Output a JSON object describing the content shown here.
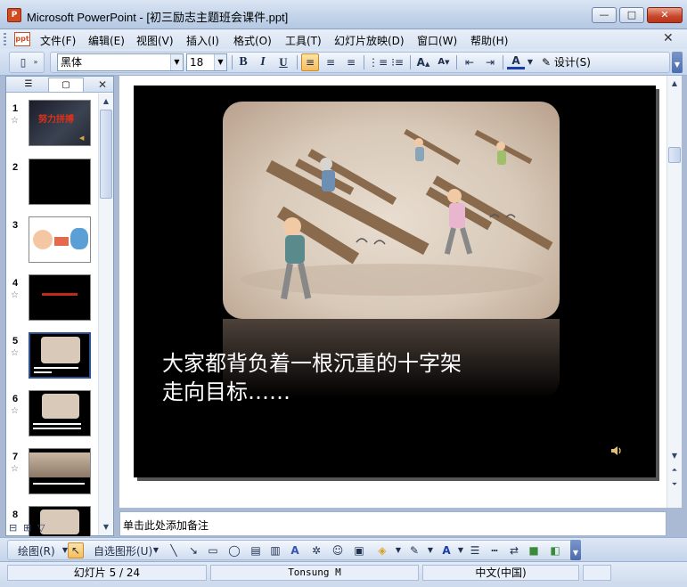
{
  "window": {
    "title": "Microsoft PowerPoint - [初三励志主题班会课件.ppt]",
    "app_icon": "P",
    "minimize_label": "—",
    "maximize_label": "□",
    "close_label": "✕"
  },
  "menubar": {
    "doc_icon": "ppt",
    "items": [
      {
        "label": "文件(F)"
      },
      {
        "label": "编辑(E)"
      },
      {
        "label": "视图(V)"
      },
      {
        "label": "插入(I)"
      },
      {
        "label": "格式(O)"
      },
      {
        "label": "工具(T)"
      },
      {
        "label": "幻灯片放映(D)"
      },
      {
        "label": "窗口(W)"
      },
      {
        "label": "帮助(H)"
      }
    ],
    "close_label": "✕"
  },
  "toolbar": {
    "font_name": "黑体",
    "font_size": "18",
    "bold": "B",
    "italic": "I",
    "underline": "U",
    "font_color_letter": "A",
    "design_label": "设计(S)"
  },
  "slides_pane": {
    "close_label": "✕",
    "thumbnails": [
      {
        "number": "1",
        "text": "努力拼搏"
      },
      {
        "number": "2"
      },
      {
        "number": "3"
      },
      {
        "number": "4"
      },
      {
        "number": "5",
        "selected": true
      },
      {
        "number": "6"
      },
      {
        "number": "7"
      },
      {
        "number": "8"
      }
    ]
  },
  "slide": {
    "caption_line1": "大家都背负着一根沉重的十字架",
    "caption_line2": "走向目标……"
  },
  "notes": {
    "placeholder": "单击此处添加备注"
  },
  "drawbar": {
    "draw_label": "绘图(R)",
    "autoshapes_label": "自选图形(U)"
  },
  "statusbar": {
    "slide_position": "幻灯片 5 / 24",
    "design_template": "Tonsung M",
    "language": "中文(中国)"
  },
  "colors": {
    "accent": "#f6bd5c",
    "title_bar": "#c3d4ea",
    "slide_background": "#000000",
    "close_button": "#c8452a"
  }
}
